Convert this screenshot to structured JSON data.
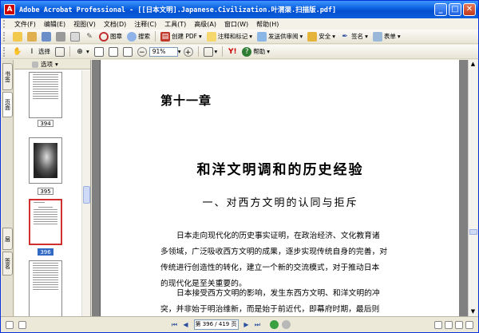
{
  "window": {
    "title": "Adobe Acrobat Professional - [[日本文明].Japanese.Civilization.叶渭渠.扫描版.pdf]",
    "app_icon": "A",
    "min": "_",
    "max": "□",
    "close": "✕"
  },
  "menu": [
    "文件(F)",
    "编辑(E)",
    "视图(V)",
    "文档(D)",
    "注释(C)",
    "工具(T)",
    "高级(A)",
    "窗口(W)",
    "帮助(H)"
  ],
  "toolbar1": {
    "create_pdf": "创建 PDF",
    "comment_markup": "注释和标记",
    "send_review": "发送供审阅",
    "security": "安全",
    "sign": "签名",
    "forms": "表单",
    "picture_label": "图章",
    "search_label": "搜索"
  },
  "toolbar2": {
    "select_label": "选择",
    "zoom_value": "91%",
    "help_label": "帮助"
  },
  "sidebar": {
    "tab_bookmarks": "书签",
    "tab_signatures": "签名",
    "tab_pages": "页面",
    "tab_layers": "层",
    "options_label": "选项",
    "thumbnails": [
      {
        "label": "394"
      },
      {
        "label": "395"
      },
      {
        "label": "396",
        "selected": true
      }
    ]
  },
  "page": {
    "chapter": "第十一章",
    "heading": "和洋文明调和的历史经验",
    "subheading": "一、对西方文明的认同与拒斥",
    "para1": [
      "日本走向现代化的历史事实证明，在政治经济、文化教育诸",
      "多领域，广泛吸收西方文明的成果，逐步实现传统自身的完善，对",
      "传统进行创造性的转化，建立一个新的交流模式，对于推动日本",
      "的现代化是至关重要的。"
    ],
    "para2": [
      "日本接受西方文明的影响，发生东西方文明、和洋文明的冲",
      "突，并非始于明治维新，而是始于前近代，即幕府时期，最后则"
    ]
  },
  "status": {
    "page_indicator": "第 396 / 419 页"
  },
  "colors": {
    "titlebar": "#0a5fdd",
    "chrome": "#ece9d8",
    "doc_bg": "#808080",
    "selection": "#316ac5"
  }
}
